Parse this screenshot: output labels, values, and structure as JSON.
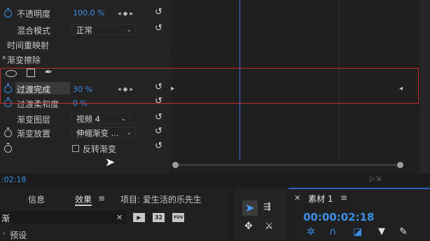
{
  "effect_controls": {
    "opacity_label": "不透明度",
    "opacity_value": "100.0 %",
    "blend_label": "混合模式",
    "blend_value": "正常",
    "time_remap_label": "时间重映射",
    "gradient_wipe_label": "渐变擦除",
    "transition_completion_label": "过渡完成",
    "transition_completion_value": "30 %",
    "transition_softness_label": "过渡柔和度",
    "transition_softness_value": "0 %",
    "gradient_layer_label": "渐变图层",
    "gradient_layer_value": "视频 4",
    "gradient_placement_label": "渐变放置",
    "gradient_placement_value": "伸缩渐变 ...",
    "invert_label": "反转渐变",
    "invert_checked": false
  },
  "timecode_small": ":02:18",
  "panels": {
    "tabs": [
      "信息",
      "效果",
      "项目: 爱生活的乐先生"
    ],
    "active_tab": "效果",
    "menu_glyph": "≡",
    "search_value": "渐",
    "search_clear": "✕",
    "presets_label": "预设",
    "chip_labels": [
      "32",
      "YUV"
    ]
  },
  "program": {
    "tab_label": "素材 1",
    "timecode": "00:00:02:18",
    "close_glyph": "✕",
    "menu_glyph": "≡"
  },
  "colors": {
    "accent_blue": "#3a8fe8",
    "highlight_red": "#c42a2a"
  }
}
